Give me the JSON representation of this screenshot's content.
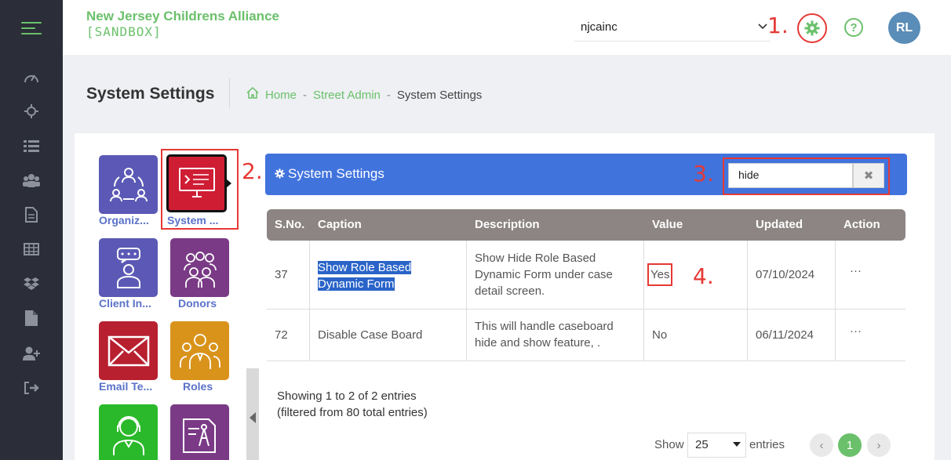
{
  "brand": {
    "line1": "New Jersey Childrens Alliance",
    "line2": "[SANDBOX]"
  },
  "header": {
    "org_value": "njcainc",
    "avatar_initials": "RL",
    "help_glyph": "?"
  },
  "annotations": {
    "a1": "1.",
    "a2": "2.",
    "a3": "3.",
    "a4": "4."
  },
  "page": {
    "title": "System Settings"
  },
  "breadcrumb": {
    "home": "Home",
    "sep": "-",
    "street_admin": "Street Admin",
    "current": "System Settings"
  },
  "tiles": [
    {
      "label": "Organiz...",
      "icon": "org-cycle-icon",
      "color": "#5b59b5"
    },
    {
      "label": "System ...",
      "icon": "monitor-settings-icon",
      "color": "#cf1d34"
    },
    {
      "label": "Client In...",
      "icon": "client-chat-icon",
      "color": "#5b59b5"
    },
    {
      "label": "Donors",
      "icon": "donors-group-icon",
      "color": "#7a3a86"
    },
    {
      "label": "Email Te...",
      "icon": "envelope-icon",
      "color": "#b81f2f"
    },
    {
      "label": "Roles",
      "icon": "roles-group-icon",
      "color": "#d9931b"
    },
    {
      "label": "",
      "icon": "support-agent-icon",
      "color": "#2ab92a"
    },
    {
      "label": "",
      "icon": "document-compass-icon",
      "color": "#7a3a86"
    }
  ],
  "panel": {
    "title": "System Settings"
  },
  "search": {
    "value": "hide",
    "clear_glyph": "✖"
  },
  "table": {
    "headers": [
      "S.No.",
      "Caption",
      "Description",
      "Value",
      "Updated",
      "Action"
    ],
    "rows": [
      {
        "sno": "37",
        "caption_l1": "Show Role Based",
        "caption_l2": "Dynamic Form",
        "desc_l1": "Show Hide Role Based",
        "desc_l2": "Dynamic Form under case",
        "desc_l3": "detail screen.",
        "value": "Yes",
        "updated": "07/10/2024",
        "action": "···"
      },
      {
        "sno": "72",
        "caption_l1": "Disable Case Board",
        "desc_l1": "This will handle caseboard",
        "desc_l2": "hide and show feature, .",
        "value": "No",
        "updated": "06/11/2024",
        "action": "···"
      }
    ]
  },
  "info": {
    "line1": "Showing 1 to 2 of 2 entries",
    "line2": "(filtered from 80 total entries)"
  },
  "length": {
    "show": "Show",
    "value": "25",
    "entries": "entries"
  },
  "pager": {
    "prev": "‹",
    "current": "1",
    "next": "›"
  },
  "colors": {
    "accent_green": "#6bc06b",
    "panel_blue": "#4173dd",
    "annotation_red": "#e53935",
    "sidebar_dark": "#2b2e38"
  }
}
